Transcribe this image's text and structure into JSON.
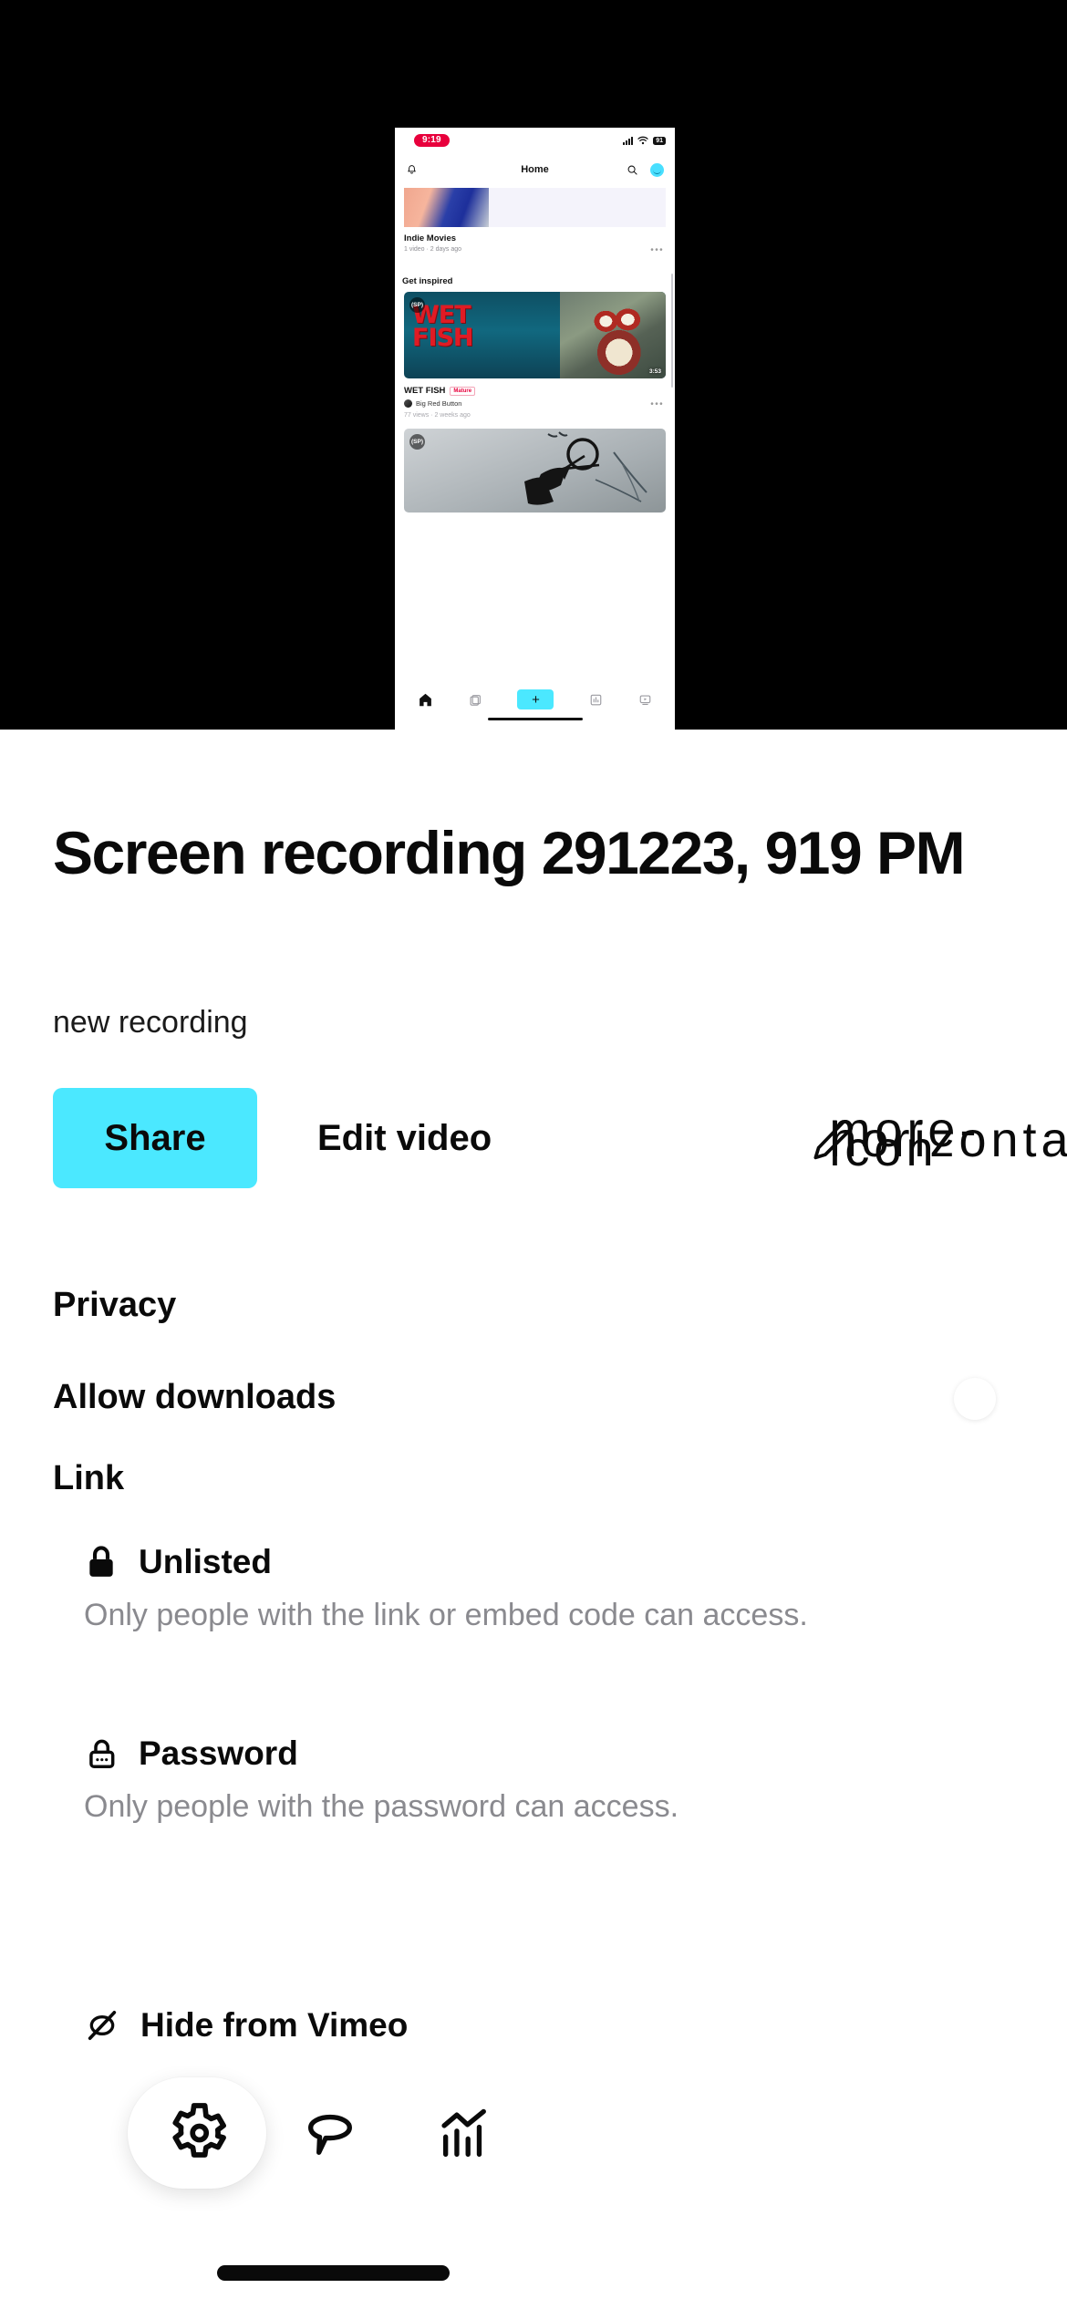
{
  "preview": {
    "name": "video-preview-frame",
    "inner_phone": {
      "status_bar": {
        "time": "9:19",
        "battery": "91",
        "signal_icon": "cellular-signal-icon",
        "wifi_icon": "wifi-icon"
      },
      "nav": {
        "title": "Home",
        "bell_icon": "bell-icon",
        "search_icon": "search-icon",
        "avatar": "avatar"
      },
      "cards": [
        {
          "title": "Indie Movies",
          "meta": "1 video · 2 days ago",
          "more_icon": "more-horizontal-icon"
        }
      ],
      "section_label": "Get inspired",
      "featured": {
        "overlay_text": "WET\nFISH",
        "badge_logo": "(SP)",
        "duration": "3:53",
        "title": "WET FISH",
        "mature_badge": "Mature",
        "channel": "Big Red Button",
        "meta": "77 views · 2 weeks ago",
        "more_icon": "more-horizontal-icon"
      },
      "second_card": {
        "badge_logo": "(SP)"
      },
      "bottom_nav": [
        {
          "name": "home-icon"
        },
        {
          "name": "library-icon"
        },
        {
          "name": "create-plus-button",
          "label": "+"
        },
        {
          "name": "analytics-icon"
        },
        {
          "name": "videos-icon"
        }
      ]
    }
  },
  "video": {
    "title": "Screen recording 291223, 919 PM",
    "description": "new recording"
  },
  "actions": {
    "share_label": "Share",
    "edit_label": "Edit video",
    "pencil_icon": "pencil-icon",
    "more_icon": "more-horizontal-icon"
  },
  "settings": {
    "privacy_label": "Privacy",
    "allow_downloads_label": "Allow downloads",
    "allow_downloads_state": "off",
    "link_label": "Link",
    "options": [
      {
        "icon": "lock-icon",
        "name": "Unlisted",
        "description": "Only people with the link or embed code can access."
      },
      {
        "icon": "lock-password-icon",
        "name": "Password",
        "description": "Only people with the password can access."
      }
    ],
    "hide_option": {
      "icon": "eye-off-icon",
      "name": "Hide from Vimeo"
    }
  },
  "floating_toolbar": [
    {
      "name": "settings-gear-icon",
      "active": true
    },
    {
      "name": "comment-icon",
      "active": false
    },
    {
      "name": "stats-icon",
      "active": false
    }
  ],
  "colors": {
    "accent": "#4BE8FF",
    "text": "#0A0A0A",
    "muted": "#8A8A8F",
    "red": "#E8003C"
  }
}
